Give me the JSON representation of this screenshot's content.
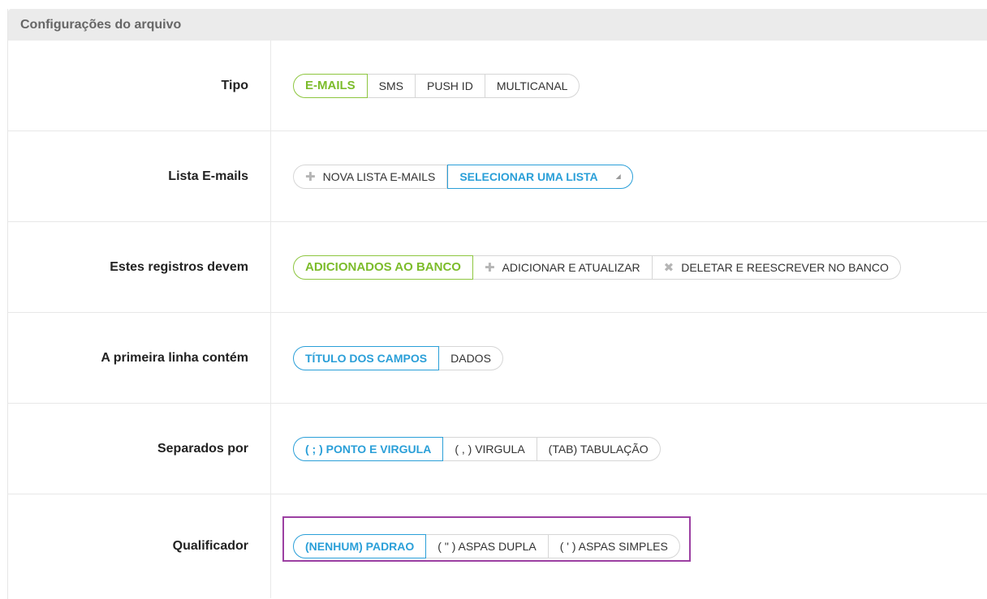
{
  "panel": {
    "title": "Configurações do arquivo"
  },
  "rows": {
    "tipo": {
      "label": "Tipo",
      "options": [
        "E-MAILS",
        "SMS",
        "PUSH ID",
        "MULTICANAL"
      ]
    },
    "lista": {
      "label": "Lista E-mails",
      "new_list": "NOVA LISTA E-MAILS",
      "select_list": "SELECIONAR UMA LISTA"
    },
    "registros": {
      "label": "Estes registros devem",
      "options": [
        "ADICIONADOS AO BANCO",
        "ADICIONAR E ATUALIZAR",
        "DELETAR E REESCREVER NO BANCO"
      ]
    },
    "primeira_linha": {
      "label": "A primeira linha contém",
      "options": [
        "TÍTULO DOS CAMPOS",
        "DADOS"
      ]
    },
    "separador": {
      "label": "Separados por",
      "options": [
        "( ; ) PONTO E VIRGULA",
        "( , ) VIRGULA",
        "(TAB) TABULAÇÃO"
      ]
    },
    "qualificador": {
      "label": "Qualificador",
      "options": [
        "(NENHUM) PADRAO",
        "( \" ) ASPAS DUPLA",
        "( ' ) ASPAS SIMPLES"
      ]
    }
  },
  "icons": {
    "plus": "plus-icon",
    "delete": "x-icon",
    "caret": "caret-down-icon"
  },
  "colors": {
    "active_green": "#7cbc2b",
    "active_blue": "#2a9fd8",
    "highlight": "#9c3fa2",
    "header_bg": "#ebebeb"
  }
}
